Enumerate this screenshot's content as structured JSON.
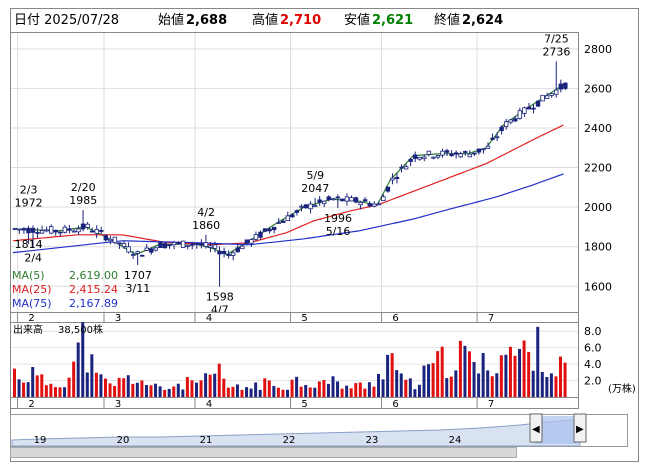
{
  "header": {
    "date_label": "日付 2025/07/28",
    "open_label": "始値",
    "open_value": "2,688",
    "high_label": "高値",
    "high_value": "2,710",
    "low_label": "安値",
    "low_value": "2,621",
    "close_label": "終値",
    "close_value": "2,624",
    "colors": {
      "high": "#e00000",
      "low": "#008000",
      "neutral": "#000000"
    }
  },
  "chart_data": [
    {
      "type": "candlestick",
      "title": "",
      "y_ticks": [
        1600,
        1800,
        2000,
        2200,
        2400,
        2600,
        2800
      ],
      "y_tick_labels": [
        "1600",
        "1800",
        "2000",
        "2200",
        "2400",
        "2600",
        "2800"
      ],
      "ylim": [
        1470,
        2880
      ],
      "month_labels": [
        {
          "label": "2",
          "x_index": 1
        },
        {
          "label": "3",
          "x_index": 20
        },
        {
          "label": "4",
          "x_index": 40
        },
        {
          "label": "5",
          "x_index": 61
        },
        {
          "label": "6",
          "x_index": 81
        },
        {
          "label": "7",
          "x_index": 102
        }
      ],
      "annotations": [
        {
          "lines": [
            "2/3",
            "1972"
          ],
          "x_index": 3,
          "value": 1972,
          "position": "above"
        },
        {
          "lines": [
            "2/20",
            "1985"
          ],
          "x_index": 15,
          "value": 1985,
          "position": "above"
        },
        {
          "lines": [
            "1814"
          ],
          "x_index": 3,
          "value": 1814,
          "position": "inline"
        },
        {
          "lines": [
            "2/4"
          ],
          "x_index": 4,
          "value": 1795,
          "position": "below"
        },
        {
          "lines": [
            "1707",
            "3/11"
          ],
          "x_index": 27,
          "value": 1707,
          "position": "below"
        },
        {
          "lines": [
            "4/2",
            "1860"
          ],
          "x_index": 42,
          "value": 1860,
          "position": "above"
        },
        {
          "lines": [
            "1598",
            "4/7"
          ],
          "x_index": 45,
          "value": 1598,
          "position": "below"
        },
        {
          "lines": [
            "5/9",
            "2047"
          ],
          "x_index": 66,
          "value": 2047,
          "position": "above"
        },
        {
          "lines": [
            "1996",
            "5/16"
          ],
          "x_index": 71,
          "value": 1996,
          "position": "below"
        },
        {
          "lines": [
            "7/25",
            "2736"
          ],
          "x_index": 119,
          "value": 2736,
          "position": "above"
        }
      ],
      "ma_legend": [
        {
          "name": "MA(5)",
          "value": "2,619.00",
          "color": "#2e7d2e"
        },
        {
          "name": "MA(25)",
          "value": "2,415.24",
          "color": "#e02020"
        },
        {
          "name": "MA(75)",
          "value": "2,167.89",
          "color": "#2030c8"
        }
      ],
      "ma_key_points": {
        "ma5": [
          [
            0,
            1890
          ],
          [
            10,
            1880
          ],
          [
            16,
            1900
          ],
          [
            22,
            1830
          ],
          [
            27,
            1760
          ],
          [
            32,
            1810
          ],
          [
            40,
            1815
          ],
          [
            44,
            1790
          ],
          [
            47,
            1760
          ],
          [
            52,
            1830
          ],
          [
            58,
            1920
          ],
          [
            64,
            2000
          ],
          [
            70,
            2040
          ],
          [
            76,
            2030
          ],
          [
            80,
            2010
          ],
          [
            83,
            2140
          ],
          [
            88,
            2260
          ],
          [
            94,
            2270
          ],
          [
            100,
            2270
          ],
          [
            104,
            2300
          ],
          [
            108,
            2420
          ],
          [
            113,
            2500
          ],
          [
            117,
            2560
          ],
          [
            121,
            2619
          ]
        ],
        "ma25": [
          [
            0,
            1830
          ],
          [
            14,
            1860
          ],
          [
            24,
            1860
          ],
          [
            34,
            1820
          ],
          [
            44,
            1810
          ],
          [
            52,
            1820
          ],
          [
            60,
            1870
          ],
          [
            66,
            1930
          ],
          [
            74,
            1980
          ],
          [
            80,
            2010
          ],
          [
            88,
            2080
          ],
          [
            96,
            2150
          ],
          [
            104,
            2220
          ],
          [
            110,
            2290
          ],
          [
            116,
            2360
          ],
          [
            121,
            2415
          ]
        ],
        "ma75": [
          [
            0,
            1770
          ],
          [
            12,
            1800
          ],
          [
            24,
            1830
          ],
          [
            40,
            1820
          ],
          [
            52,
            1810
          ],
          [
            64,
            1840
          ],
          [
            76,
            1880
          ],
          [
            88,
            1940
          ],
          [
            96,
            1990
          ],
          [
            106,
            2050
          ],
          [
            114,
            2110
          ],
          [
            121,
            2168
          ]
        ]
      },
      "candle_count": 122
    },
    {
      "type": "bar",
      "title": "出来高",
      "subtitle": "38,500株",
      "unit_label": "(万株)",
      "y_ticks": [
        2.0,
        4.0,
        6.0,
        8.0
      ],
      "y_tick_labels": [
        "2.0",
        "4.0",
        "6.0",
        "8.0"
      ],
      "ylim": [
        0,
        9
      ],
      "values_key_points": [
        [
          0,
          3.0
        ],
        [
          2,
          2.4
        ],
        [
          4,
          2.8
        ],
        [
          6,
          1.9
        ],
        [
          9,
          1.6
        ],
        [
          12,
          2.5
        ],
        [
          15,
          6.8
        ],
        [
          18,
          2.3
        ],
        [
          21,
          1.5
        ],
        [
          24,
          2.0
        ],
        [
          27,
          2.4
        ],
        [
          30,
          1.2
        ],
        [
          33,
          1.0
        ],
        [
          36,
          1.5
        ],
        [
          40,
          1.8
        ],
        [
          43,
          2.0
        ],
        [
          45,
          3.0
        ],
        [
          47,
          1.2
        ],
        [
          50,
          1.0
        ],
        [
          54,
          1.6
        ],
        [
          58,
          1.4
        ],
        [
          62,
          2.0
        ],
        [
          66,
          1.7
        ],
        [
          70,
          1.8
        ],
        [
          74,
          1.2
        ],
        [
          78,
          1.5
        ],
        [
          81,
          3.5
        ],
        [
          83,
          5.2
        ],
        [
          85,
          2.0
        ],
        [
          88,
          1.4
        ],
        [
          92,
          3.8
        ],
        [
          96,
          4.5
        ],
        [
          99,
          5.0
        ],
        [
          102,
          3.5
        ],
        [
          105,
          4.2
        ],
        [
          108,
          5.5
        ],
        [
          111,
          5.1
        ],
        [
          113,
          5.4
        ],
        [
          116,
          6.0
        ],
        [
          118,
          3.0
        ],
        [
          121,
          3.8
        ]
      ]
    }
  ],
  "navigator": {
    "labels": [
      "19",
      "20",
      "21",
      "22",
      "23",
      "24"
    ],
    "scroll_left_label": "◀",
    "scroll_right_label": "▶"
  }
}
